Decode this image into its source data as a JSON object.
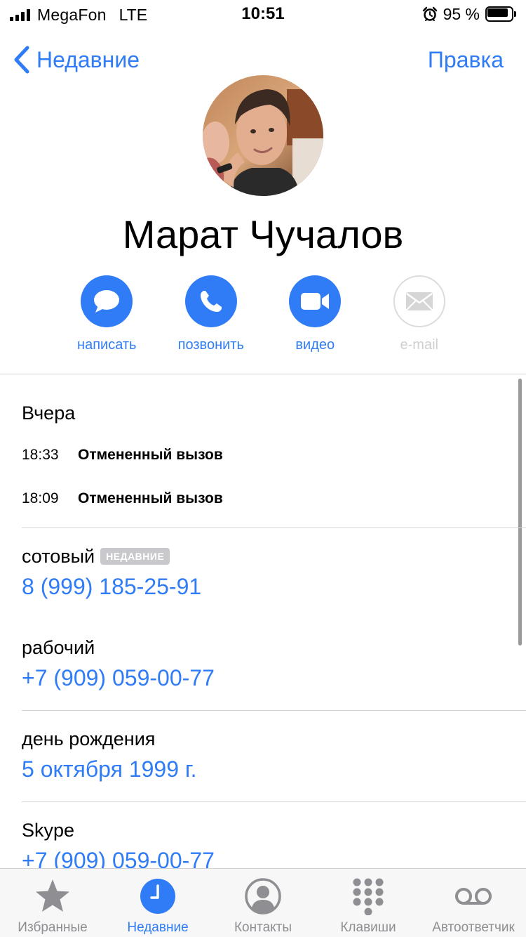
{
  "status_bar": {
    "carrier": "MegaFon",
    "network": "LTE",
    "time": "10:51",
    "battery": "95 %",
    "battery_level_percent": 95
  },
  "nav": {
    "back_label": "Недавние",
    "edit_label": "Правка"
  },
  "contact": {
    "name": "Марат Чучалов"
  },
  "actions": [
    {
      "label": "написать",
      "icon": "message-icon",
      "enabled": true
    },
    {
      "label": "позвонить",
      "icon": "phone-icon",
      "enabled": true
    },
    {
      "label": "видео",
      "icon": "video-icon",
      "enabled": true
    },
    {
      "label": "e-mail",
      "icon": "mail-icon",
      "enabled": false
    }
  ],
  "recents": {
    "day": "Вчера",
    "calls": [
      {
        "time": "18:33",
        "status": "Отмененный вызов"
      },
      {
        "time": "18:09",
        "status": "Отмененный вызов"
      }
    ]
  },
  "fields": [
    {
      "label": "сотовый",
      "badge": "НЕДАВНИЕ",
      "value": "8 (999) 185-25-91"
    },
    {
      "label": "рабочий",
      "value": "+7 (909) 059-00-77"
    },
    {
      "label": "день рождения",
      "value": "5 октября 1999 г."
    },
    {
      "label": "Skype",
      "value": "+7 (909) 059-00-77"
    }
  ],
  "tabs": [
    {
      "label": "Избранные",
      "icon": "star-icon",
      "active": false
    },
    {
      "label": "Недавние",
      "icon": "clock-icon",
      "active": true
    },
    {
      "label": "Контакты",
      "icon": "person-icon",
      "active": false
    },
    {
      "label": "Клавиши",
      "icon": "keypad-icon",
      "active": false
    },
    {
      "label": "Автоответчик",
      "icon": "voicemail-icon",
      "active": false
    }
  ],
  "colors": {
    "accent": "#2f7cf6",
    "tab_inactive": "#8e8e93",
    "badge": "#c9c9cd",
    "divider": "#d6d6d6"
  }
}
